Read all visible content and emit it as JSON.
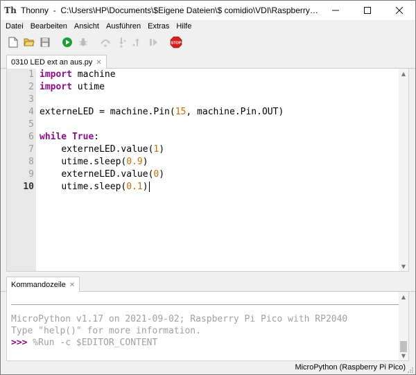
{
  "window": {
    "app_name": "Thonny",
    "path": "C:\\Users\\HP\\Documents\\$Eigene Dateien\\$ comidio\\VDI\\Raspberry Pi\\Pico\\Pico P..."
  },
  "menu": {
    "items": [
      "Datei",
      "Bearbeiten",
      "Ansicht",
      "Ausführen",
      "Extras",
      "Hilfe"
    ]
  },
  "toolbar": {
    "buttons": [
      "new-file",
      "open-file",
      "save-file",
      "run",
      "debug",
      "step-over",
      "step-into",
      "step-out",
      "resume",
      "stop"
    ],
    "stop_label": "STOP"
  },
  "editor": {
    "tab_title": "0310 LED ext an aus.py",
    "line_numbers": [
      "1",
      "2",
      "3",
      "4",
      "5",
      "6",
      "7",
      "8",
      "9",
      "10"
    ],
    "lines": [
      "import machine",
      "import utime",
      "",
      "externeLED = machine.Pin(15, machine.Pin.OUT)",
      "",
      "while True:",
      "    externeLED.value(1)",
      "    utime.sleep(0.9)",
      "    externeLED.value(0)",
      "    utime.sleep(0.1)"
    ],
    "current_line": 10
  },
  "shell": {
    "tab_title": "Kommandozeile",
    "output": [
      "MicroPython v1.17 on 2021-09-02; Raspberry Pi Pico with RP2040",
      "Type \"help()\" for more information."
    ],
    "prompt": ">>>",
    "command": " %Run -c $EDITOR_CONTENT"
  },
  "status": {
    "interpreter": "MicroPython (Raspberry Pi Pico)"
  },
  "colors": {
    "keyword": "#8a0e8a",
    "number": "#c46e00",
    "run_green": "#1e9e3a",
    "stop_red": "#d42020"
  }
}
